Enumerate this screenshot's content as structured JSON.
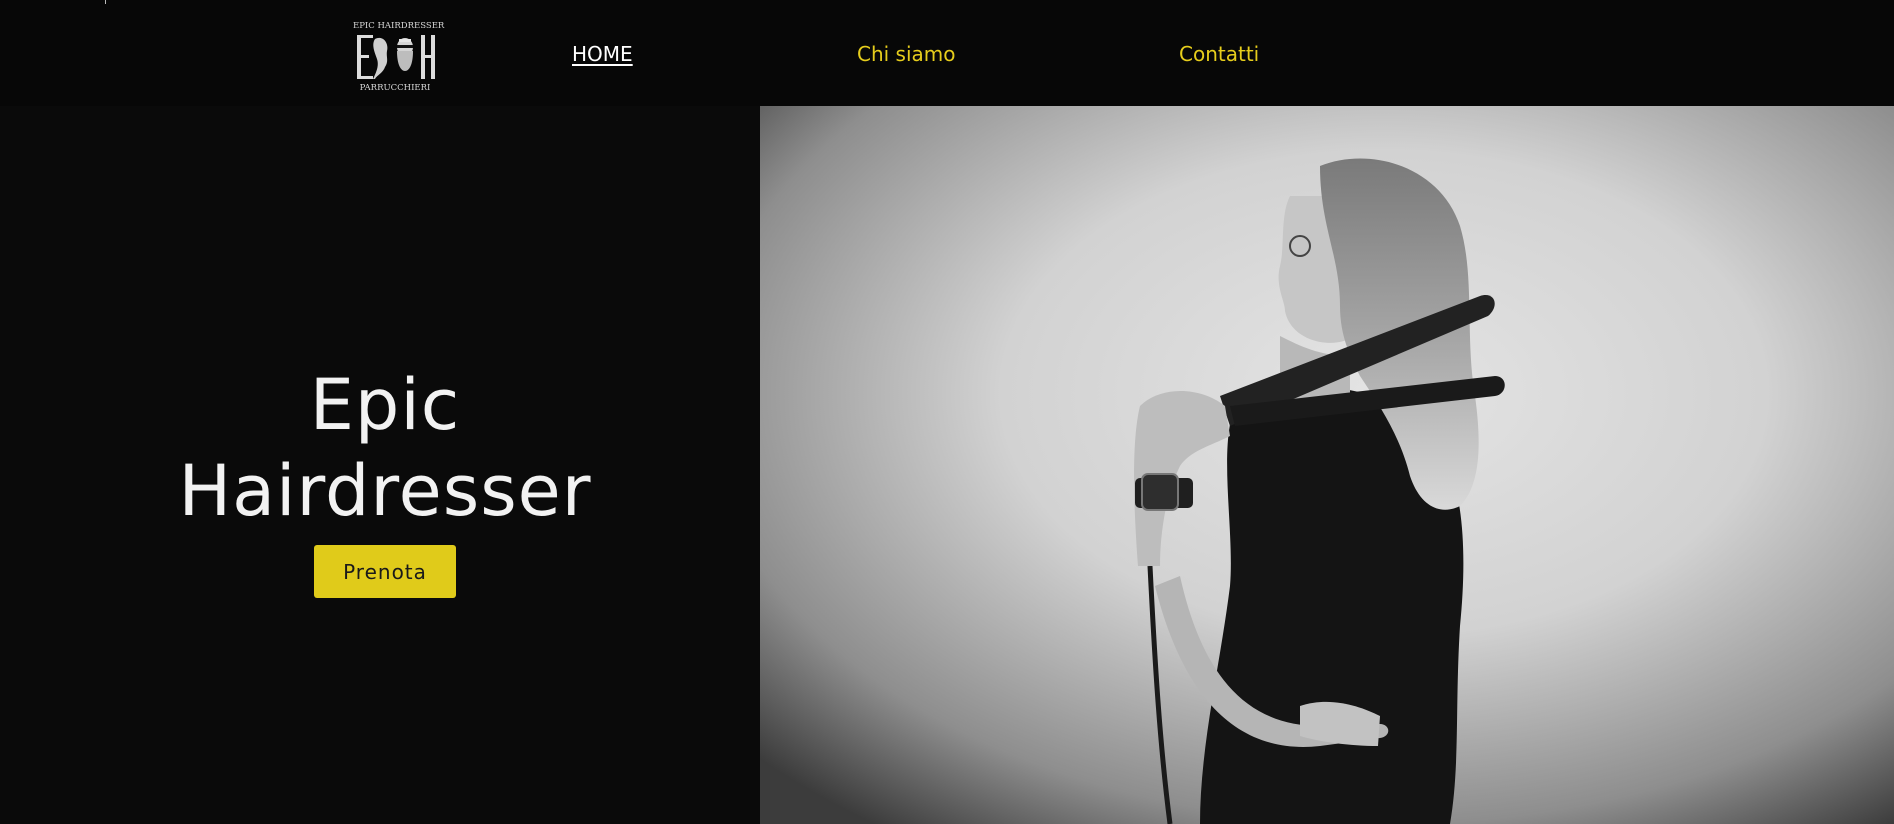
{
  "header": {
    "logo": {
      "top_text": "EPIC HAIRDRESSER",
      "monogram": "EH",
      "bottom_text": "PARRUCCHIERI"
    },
    "nav": [
      {
        "label": "HOME",
        "active": true
      },
      {
        "label": "Chi siamo",
        "active": false
      },
      {
        "label": "Contatti",
        "active": false
      }
    ]
  },
  "hero": {
    "title_line1": "Epic",
    "title_line2": "Hairdresser",
    "cta_label": "Prenota",
    "image": "black-and-white-photo-of-hairdresser-holding-hair-straightener"
  },
  "colors": {
    "background": "#0a0a0a",
    "accent": "#e0cb1a",
    "nav_link": "#e6cd1c",
    "nav_active": "#ffffff",
    "title": "#f2f2f2"
  }
}
